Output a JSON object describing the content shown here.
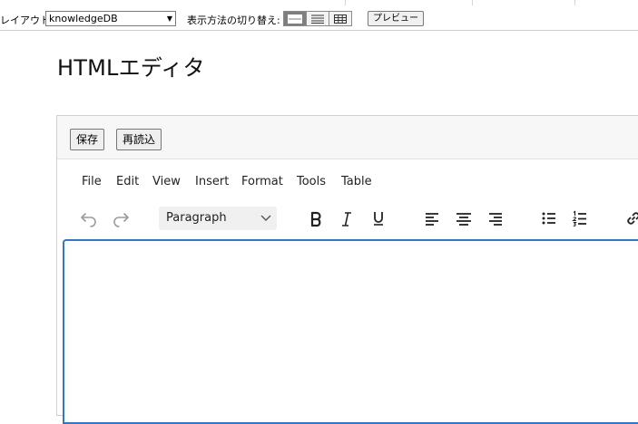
{
  "toolbar": {
    "layout_label": "レイアウト:",
    "layout_value": "knowledgeDB",
    "display_label": "表示方法の切り替え:",
    "preview_label": "プレビュー"
  },
  "page": {
    "title": "HTMLエディタ"
  },
  "editor": {
    "save_label": "保存",
    "reload_label": "再読込",
    "menus": [
      "File",
      "Edit",
      "View",
      "Insert",
      "Format",
      "Tools",
      "Table"
    ],
    "block_format": "Paragraph",
    "content": ""
  },
  "colors": {
    "focus_border": "#2f78c4",
    "active_view_button": "#7f7f7f"
  }
}
